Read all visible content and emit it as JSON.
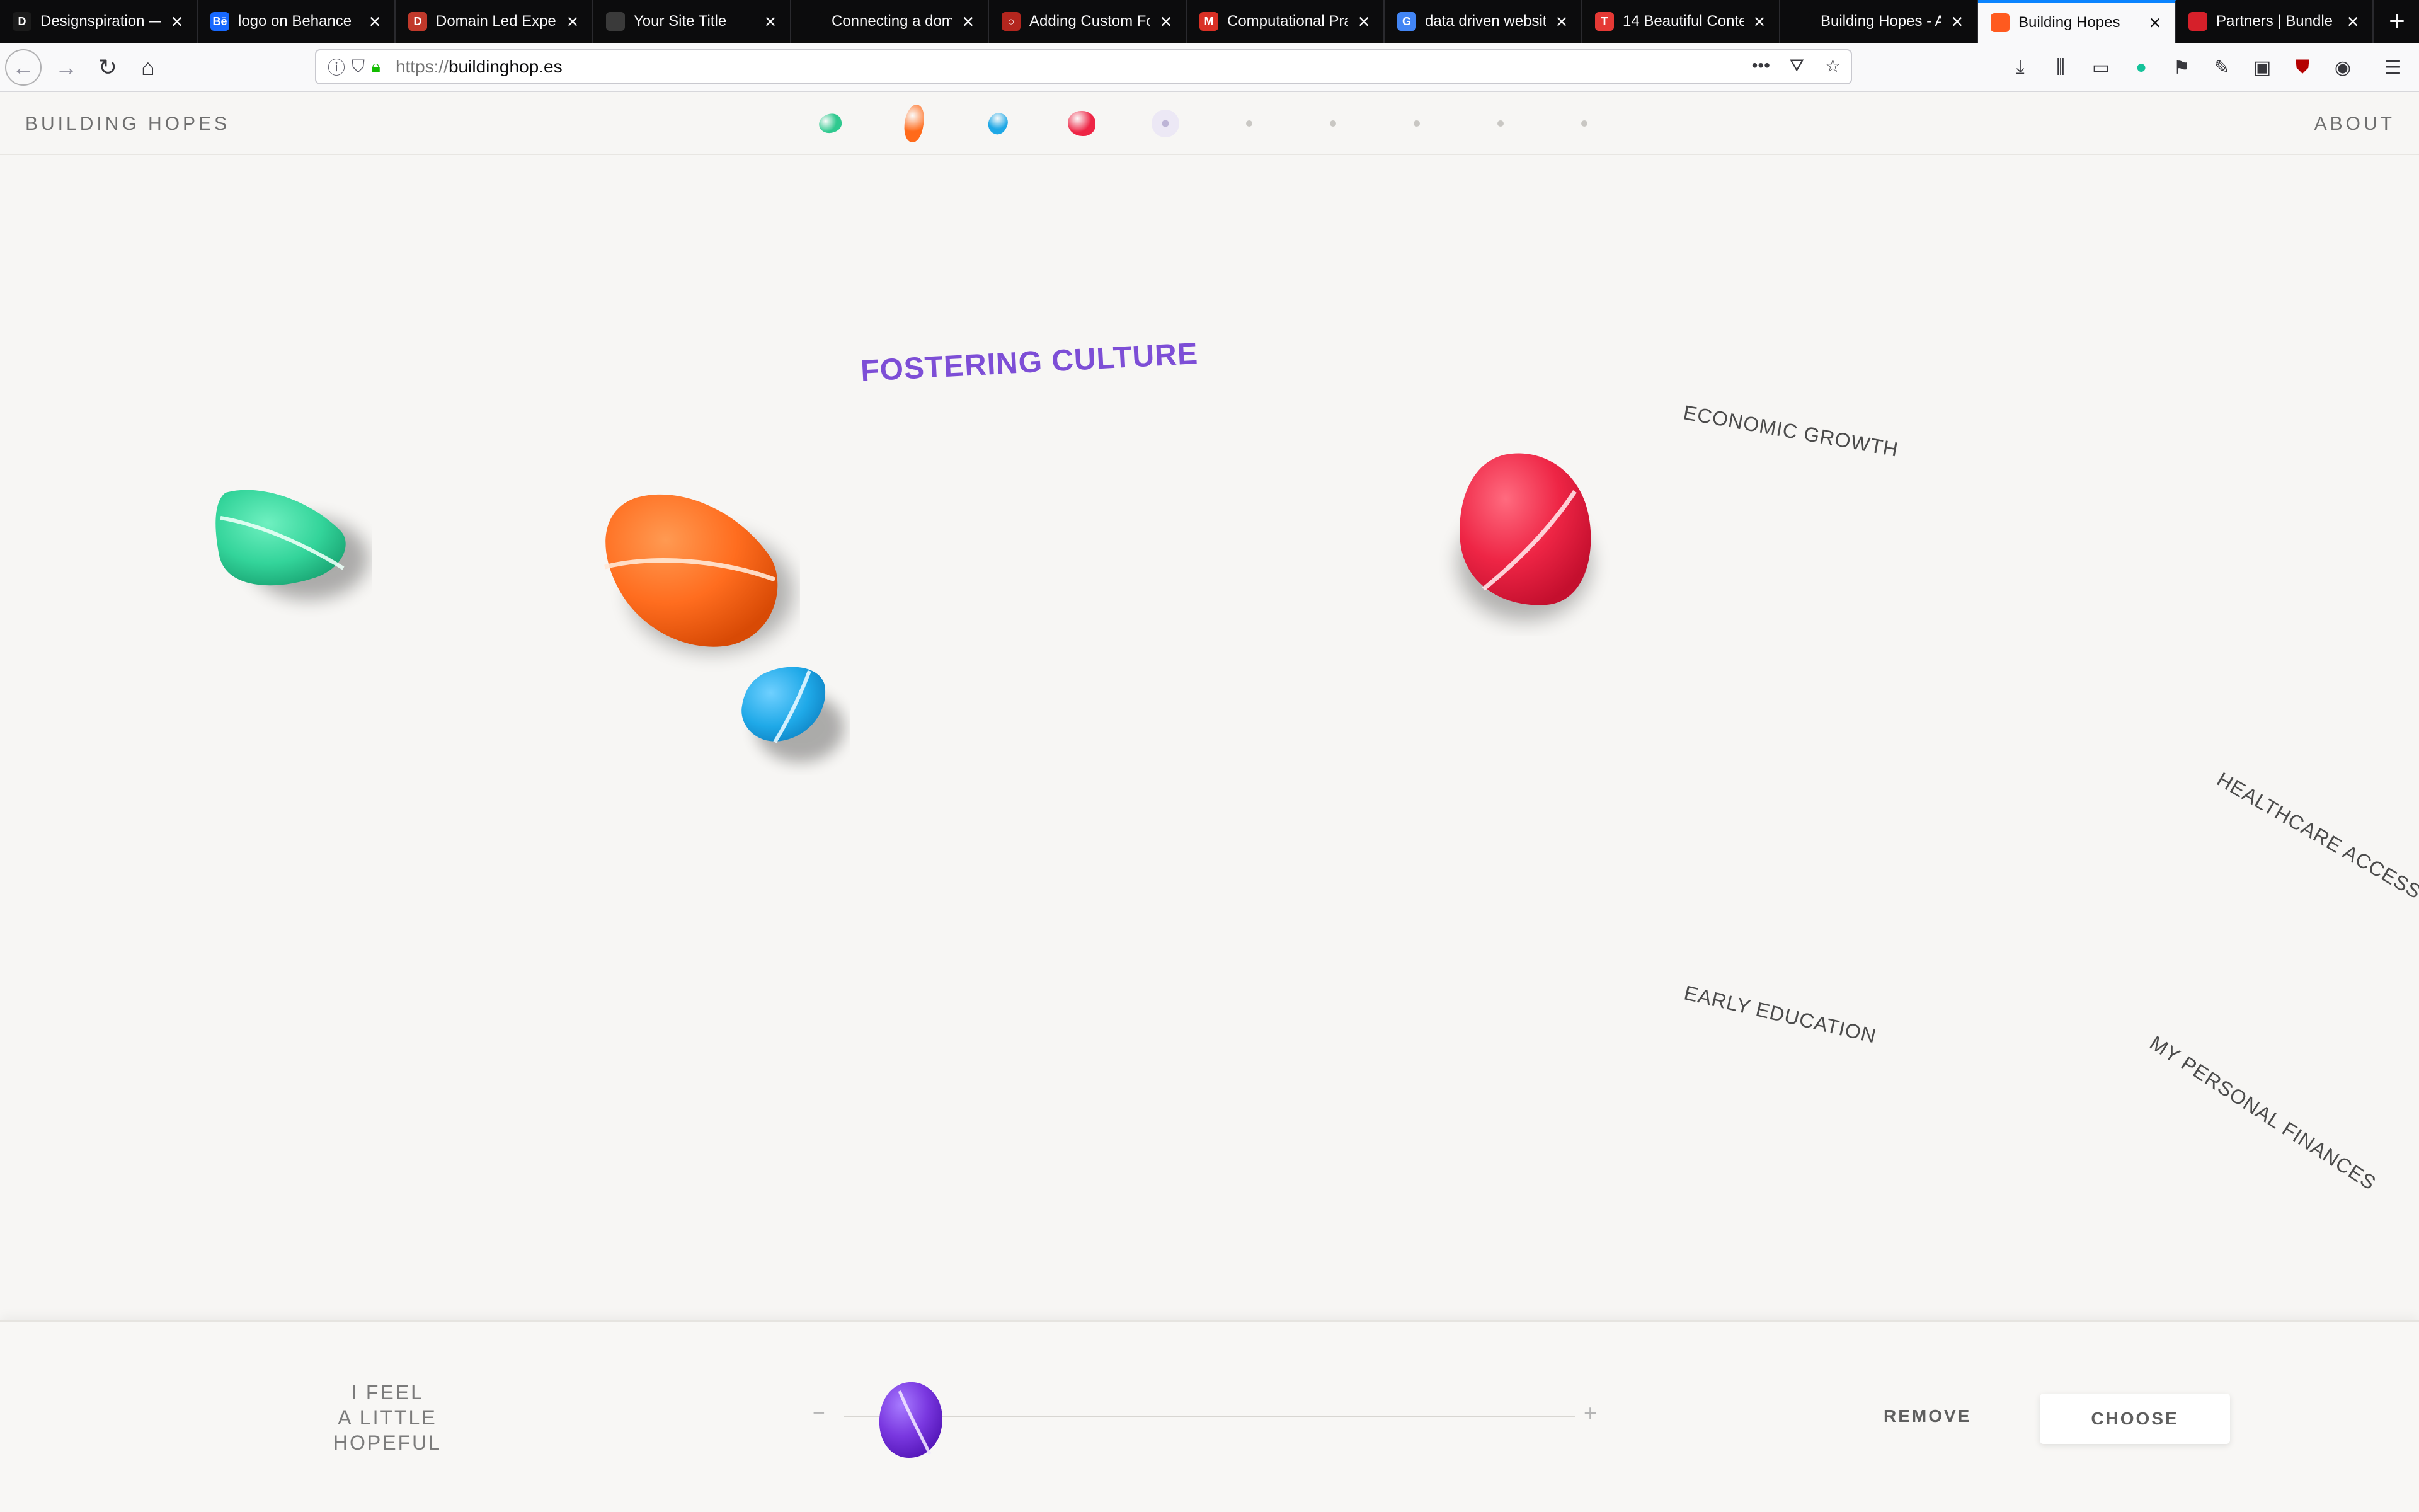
{
  "browser": {
    "tabs": [
      {
        "title": "Designspiration — ",
        "favicon_letter": "D",
        "favicon_color": "#1b1b1b"
      },
      {
        "title": "logo on Behance",
        "favicon_letter": "Bē",
        "favicon_color": "#1769ff"
      },
      {
        "title": "Domain Led Exper",
        "favicon_letter": "D",
        "favicon_color": "#c0392b"
      },
      {
        "title": "Your Site Title",
        "favicon_letter": "",
        "favicon_color": "#3a3a3a"
      },
      {
        "title": "Connecting a dom",
        "favicon_letter": "",
        "favicon_color": "#0c0c0d"
      },
      {
        "title": "Adding Custom Fo",
        "favicon_letter": "○",
        "favicon_color": "#b3261e"
      },
      {
        "title": "Computational Pra",
        "favicon_letter": "M",
        "favicon_color": "#d93025"
      },
      {
        "title": "data driven websit",
        "favicon_letter": "G",
        "favicon_color": "#4285f4"
      },
      {
        "title": "14 Beautiful Conte",
        "favicon_letter": "T",
        "favicon_color": "#e53935"
      },
      {
        "title": "Building Hopes - A",
        "favicon_letter": "",
        "favicon_color": "#0c0c0d"
      },
      {
        "title": "Building Hopes",
        "favicon_letter": "",
        "favicon_color": "#ff5a1f",
        "active": true
      },
      {
        "title": "Partners | Bundle I",
        "favicon_letter": "",
        "favicon_color": "#d6202a"
      }
    ],
    "url_scheme": "https://",
    "url_host": "buildinghop.es",
    "new_tab_label": "+"
  },
  "site": {
    "logo": "BUILDING HOPES",
    "about": "ABOUT",
    "nav_pebbles": [
      {
        "color": "#2fc98f",
        "name": "nav-pebble-green"
      },
      {
        "color": "#ff6a1a",
        "name": "nav-pebble-orange"
      },
      {
        "color": "#1fa8e6",
        "name": "nav-pebble-blue"
      },
      {
        "color": "#ee2545",
        "name": "nav-pebble-red"
      }
    ]
  },
  "stage": {
    "words": {
      "culture": "FOSTERING CULTURE",
      "economic": "ECONOMIC GROWTH",
      "healthcare": "HEALTHCARE ACCESS",
      "education": "EARLY EDUCATION",
      "finances": "MY PERSONAL FINANCES"
    },
    "pebble_colors": {
      "green": "#33d49a",
      "orange": "#ff6d1f",
      "blue": "#1fa9e8",
      "red": "#ee2545",
      "purple": "#7a38e0"
    }
  },
  "controls": {
    "feel_line1": "I FEEL",
    "feel_line2": "A LITTLE",
    "feel_line3": "HOPEFUL",
    "minus": "−",
    "plus": "+",
    "remove": "REMOVE",
    "choose": "CHOOSE"
  }
}
